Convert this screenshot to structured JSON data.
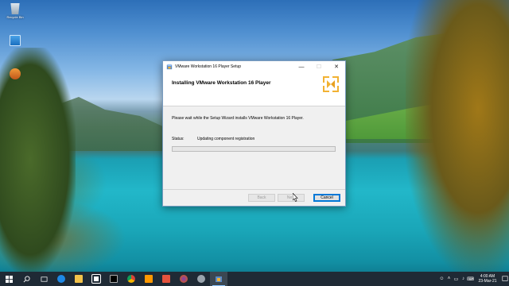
{
  "desktop": {
    "icons": [
      {
        "label": "Recycle Bin",
        "icon": "recycle-bin-icon"
      },
      {
        "label": "",
        "icon": "computer-icon"
      },
      {
        "label": "",
        "icon": "app-icon"
      }
    ]
  },
  "dialog": {
    "window_title": "VMware Workstation 16 Player Setup",
    "header_title": "Installing VMware Workstation 16 Player",
    "info_text": "Please wait while the Setup Wizard installs VMware Workstation 16 Player.",
    "status_label": "Status:",
    "status_value": "Updating component registration",
    "progress_fraction": 0.0,
    "buttons": {
      "back": "Back",
      "next": "Next",
      "cancel": "Cancel"
    },
    "window_controls": {
      "minimize": "—",
      "maximize": "☐",
      "close": "✕"
    }
  },
  "taskbar": {
    "apps": [
      "start-icon",
      "search-icon",
      "task-view-icon",
      "edge-icon",
      "file-explorer-icon",
      "store-icon",
      "terminal-icon",
      "chrome-icon",
      "sublime-icon",
      "firefox-icon",
      "settings-icon",
      "vmware-setup-icon"
    ],
    "clock_time": "4:00 AM",
    "clock_date": "23-Mar-21"
  },
  "colors": {
    "progress_green": "#06b025",
    "accent_blue": "#0078d7",
    "taskbar": "#1f2a35"
  }
}
